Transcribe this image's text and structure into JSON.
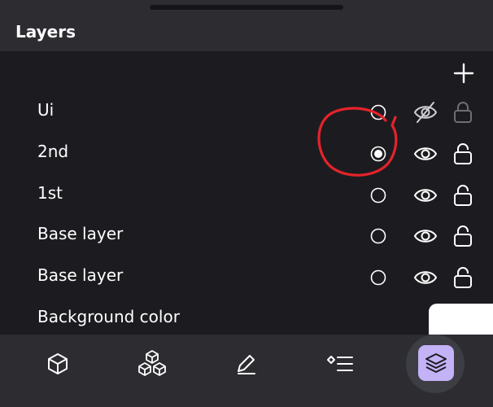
{
  "header": {
    "title": "Layers"
  },
  "actions": {
    "add_icon": "plus-icon"
  },
  "layers": [
    {
      "name": "Ui",
      "active": false,
      "visible": false,
      "locked": true
    },
    {
      "name": "2nd",
      "active": true,
      "visible": true,
      "locked": false
    },
    {
      "name": "1st",
      "active": false,
      "visible": true,
      "locked": false
    },
    {
      "name": "Base layer",
      "active": false,
      "visible": true,
      "locked": false
    },
    {
      "name": "Base layer",
      "active": false,
      "visible": true,
      "locked": false
    }
  ],
  "background": {
    "label": "Background color",
    "color": "#ffffff"
  },
  "annotation": {
    "color": "#e5232a",
    "shape": "hand-drawn-circle"
  },
  "toolbar": {
    "items": [
      {
        "icon": "cube-icon",
        "active": false
      },
      {
        "icon": "cubes-icon",
        "active": false
      },
      {
        "icon": "pencil-icon",
        "active": false
      },
      {
        "icon": "list-icon",
        "active": false
      },
      {
        "icon": "layers-icon",
        "active": true
      }
    ],
    "active_color": "#c3b2f6"
  }
}
